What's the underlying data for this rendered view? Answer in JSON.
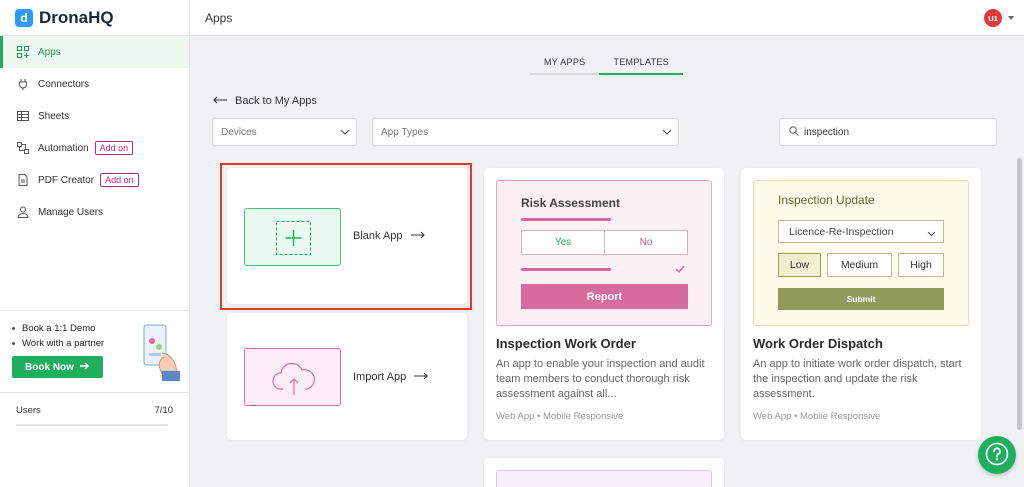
{
  "brand": {
    "name": "DronaHQ",
    "logo_glyph": "d"
  },
  "header": {
    "title": "Apps",
    "avatar_initials": "U1"
  },
  "sidebar": {
    "items": [
      {
        "label": "Apps",
        "icon": "apps-grid-icon",
        "active": true
      },
      {
        "label": "Connectors",
        "icon": "plug-icon"
      },
      {
        "label": "Sheets",
        "icon": "table-icon"
      },
      {
        "label": "Automation",
        "icon": "automation-icon",
        "badge": "Add on"
      },
      {
        "label": "PDF Creator",
        "icon": "pdf-icon",
        "badge": "Add on"
      },
      {
        "label": "Manage Users",
        "icon": "user-icon"
      }
    ],
    "promo": {
      "line1": "Book a 1:1 Demo",
      "line2": "Work with a partner",
      "button": "Book Now"
    },
    "users": {
      "label": "Users",
      "count": "7/10"
    }
  },
  "tabs": [
    {
      "label": "MY APPS"
    },
    {
      "label": "TEMPLATES",
      "active": true
    }
  ],
  "back_link": "Back to My Apps",
  "filters": {
    "devices_placeholder": "Devices",
    "app_types_placeholder": "App Types",
    "search_value": "inspection"
  },
  "blank_app": {
    "label": "Blank App"
  },
  "import_app": {
    "label": "Import App"
  },
  "templates": [
    {
      "preview": {
        "heading": "Risk Assessment",
        "yes": "Yes",
        "no": "No",
        "button": "Report"
      },
      "title": "Inspection Work Order",
      "description": "An app to enable your inspection and audit team members to conduct thorough risk assessment against all...",
      "meta": "Web App • Mobile Responsive"
    },
    {
      "preview": {
        "heading": "Inspection Update",
        "select": "Licence-Re-Inspection",
        "low": "Low",
        "medium": "Medium",
        "high": "High",
        "button": "Submit"
      },
      "title": "Work Order Dispatch",
      "description": "An app to initiate work order dispatch, start the inspection and update the risk assessment.",
      "meta": "Web App • Mobile Responsive"
    }
  ],
  "colors": {
    "accent": "#1fae5e",
    "addon": "#c9257a",
    "highlight": "#e5392e",
    "risk_pink": "#d9679d",
    "inspection_olive": "#8f9a5b"
  }
}
